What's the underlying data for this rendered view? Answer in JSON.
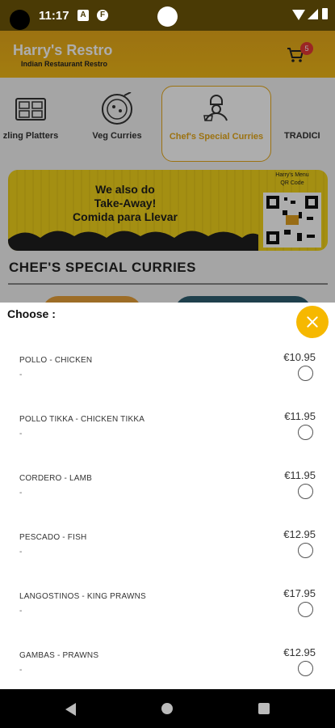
{
  "status_bar": {
    "time": "11:17",
    "icon_a": "A",
    "icon_f": "F"
  },
  "app": {
    "title": "Harry's Restro",
    "subtitle": "Indian Restaurant Restro",
    "cart_count": "5"
  },
  "categories": [
    {
      "label": "zling Platters",
      "icon": "platter-icon"
    },
    {
      "label": "Veg Curries",
      "icon": "bowl-icon"
    },
    {
      "label": "Chef's Special Curries",
      "icon": "chef-icon",
      "selected": true
    },
    {
      "label": "TRADICI",
      "icon": ""
    }
  ],
  "banner": {
    "line1": "We also do",
    "line2": "Take-Away!",
    "line3": "Comida para Llevar",
    "qr_title_1": "Harry's Menu",
    "qr_title_2": "QR Code"
  },
  "section_title": "CHEF'S SPECIAL CURRIES",
  "sheet": {
    "title": "Choose :",
    "options": [
      {
        "name": "POLLO - CHICKEN",
        "desc": "-",
        "price": "€10.95"
      },
      {
        "name": "POLLO TIKKA - CHICKEN TIKKA",
        "desc": "-",
        "price": "€11.95"
      },
      {
        "name": "CORDERO - LAMB",
        "desc": "-",
        "price": "€11.95"
      },
      {
        "name": "PESCADO - FISH",
        "desc": "-",
        "price": "€12.95"
      },
      {
        "name": "LANGOSTINOS - KING PRAWNS",
        "desc": "-",
        "price": "€17.95"
      },
      {
        "name": "GAMBAS - PRAWNS",
        "desc": "-",
        "price": "€12.95"
      }
    ]
  },
  "colors": {
    "accent": "#f6b800",
    "banner": "#f2d31b",
    "selected_tab": "#e6a91a"
  }
}
